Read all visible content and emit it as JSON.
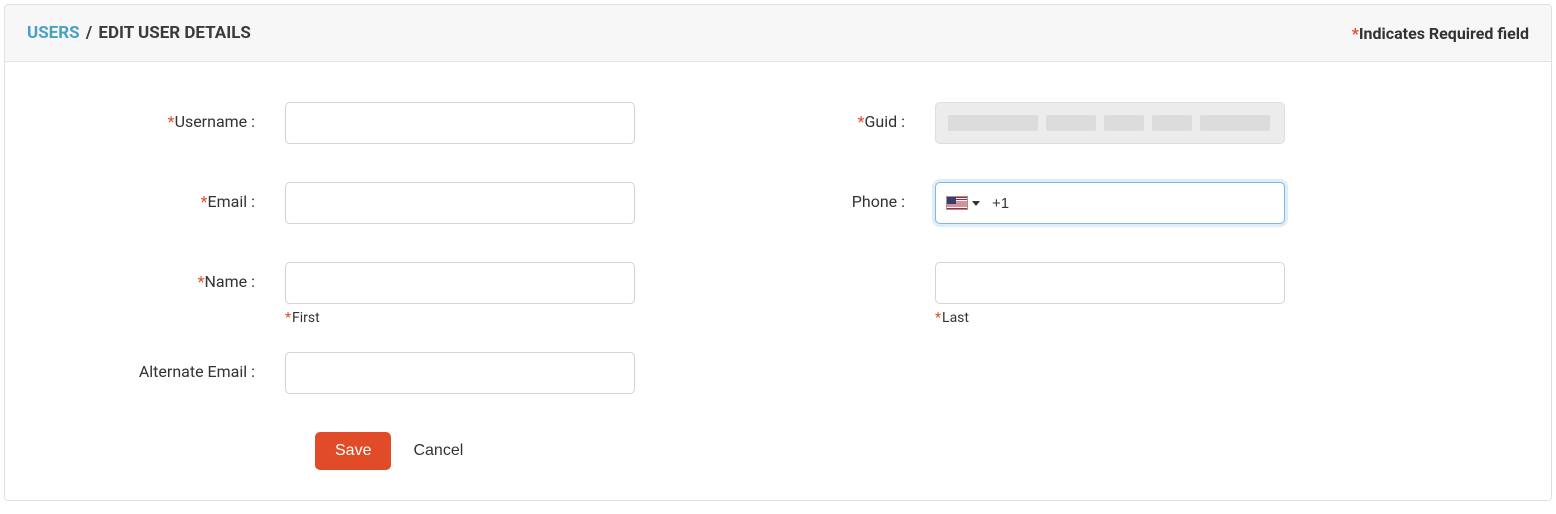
{
  "header": {
    "breadcrumb_root": "USERS",
    "breadcrumb_sep": "/",
    "breadcrumb_current": "EDIT USER DETAILS",
    "required_note_star": "*",
    "required_note_text": "Indicates Required field"
  },
  "form": {
    "username": {
      "label": "Username :",
      "value": "",
      "required": true
    },
    "guid": {
      "label": "Guid :",
      "value": "",
      "required": true
    },
    "email": {
      "label": "Email :",
      "value": "",
      "required": true
    },
    "phone": {
      "label": "Phone :",
      "value": "+1",
      "country": "US",
      "required": false
    },
    "name": {
      "label": "Name :",
      "required": true
    },
    "first": {
      "sublabel": "First",
      "value": "",
      "required": true
    },
    "last": {
      "sublabel": "Last",
      "value": "",
      "required": true
    },
    "alt_email": {
      "label": "Alternate Email :",
      "value": "",
      "required": false
    }
  },
  "actions": {
    "save": "Save",
    "cancel": "Cancel"
  }
}
